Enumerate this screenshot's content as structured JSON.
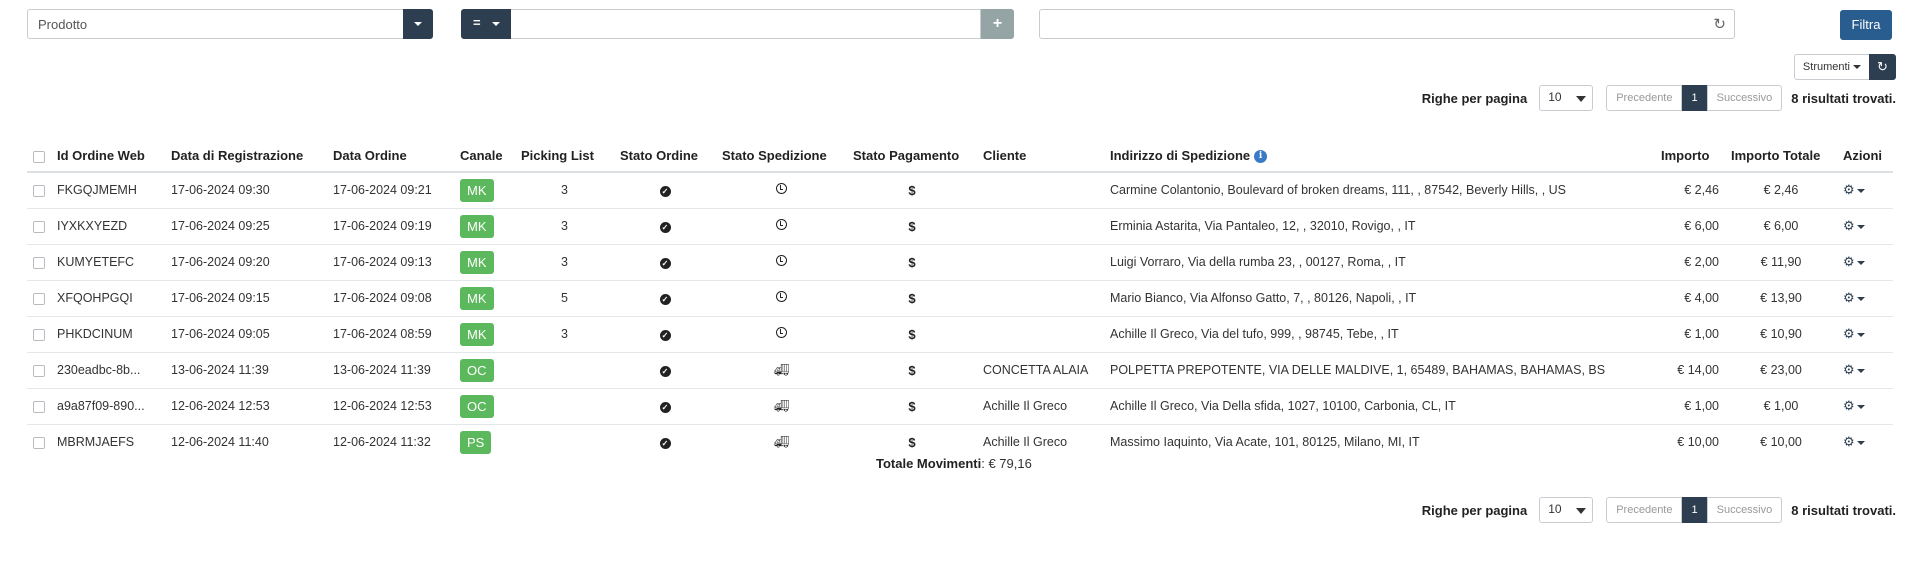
{
  "filter": {
    "field_value": "Prodotto",
    "operator_label": "=",
    "value_input": "",
    "add_label": "+",
    "search_value": "",
    "filtra_label": "Filtra"
  },
  "tools": {
    "strumenti_label": "Strumenti",
    "reload_icon": "refresh-icon"
  },
  "pagination": {
    "rows_label": "Righe per pagina",
    "rows_value": "10",
    "prev_label": "Precedente",
    "current_page": "1",
    "next_label": "Successivo",
    "results_text": "8 risultati trovati."
  },
  "table": {
    "headers": {
      "id": "Id Ordine Web",
      "reg": "Data di Registrazione",
      "date": "Data Ordine",
      "channel": "Canale",
      "picking": "Picking List",
      "order_state": "Stato Ordine",
      "ship_state": "Stato Spedizione",
      "pay_state": "Stato Pagamento",
      "client": "Cliente",
      "address": "Indirizzo di Spedizione",
      "amount": "Importo",
      "total": "Importo Totale",
      "actions": "Azioni"
    },
    "rows": [
      {
        "id": "FKGQJMEMH",
        "reg": "17-06-2024 09:30",
        "date": "17-06-2024 09:21",
        "channel": "MK",
        "picking": "3",
        "ship": "clock",
        "client": "",
        "address": "Carmine Colantonio, Boulevard of broken dreams, 111, , 87542, Beverly Hills, , US",
        "amount": "€ 2,46",
        "total": "€ 2,46"
      },
      {
        "id": "IYXKXYEZD",
        "reg": "17-06-2024 09:25",
        "date": "17-06-2024 09:19",
        "channel": "MK",
        "picking": "3",
        "ship": "clock",
        "client": "",
        "address": "Erminia Astarita, Via Pantaleo, 12, , 32010, Rovigo, , IT",
        "amount": "€ 6,00",
        "total": "€ 6,00"
      },
      {
        "id": "KUMYETEFC",
        "reg": "17-06-2024 09:20",
        "date": "17-06-2024 09:13",
        "channel": "MK",
        "picking": "3",
        "ship": "clock",
        "client": "",
        "address": "Luigi Vorraro, Via della rumba 23, , 00127, Roma, , IT",
        "amount": "€ 2,00",
        "total": "€ 11,90"
      },
      {
        "id": "XFQOHPGQI",
        "reg": "17-06-2024 09:15",
        "date": "17-06-2024 09:08",
        "channel": "MK",
        "picking": "5",
        "ship": "clock",
        "client": "",
        "address": "Mario Bianco, Via Alfonso Gatto, 7, , 80126, Napoli, , IT",
        "amount": "€ 4,00",
        "total": "€ 13,90"
      },
      {
        "id": "PHKDCINUM",
        "reg": "17-06-2024 09:05",
        "date": "17-06-2024 08:59",
        "channel": "MK",
        "picking": "3",
        "ship": "clock",
        "client": "",
        "address": "Achille Il Greco, Via del tufo, 999, , 98745, Tebe, , IT",
        "amount": "€ 1,00",
        "total": "€ 10,90"
      },
      {
        "id": "230eadbc-8b...",
        "reg": "13-06-2024 11:39",
        "date": "13-06-2024 11:39",
        "channel": "OC",
        "picking": "",
        "ship": "truck",
        "client": "CONCETTA ALAIA",
        "address": "POLPETTA PREPOTENTE, VIA DELLE MALDIVE, 1, 65489, BAHAMAS, BAHAMAS, BS",
        "amount": "€ 14,00",
        "total": "€ 23,00"
      },
      {
        "id": "a9a87f09-890...",
        "reg": "12-06-2024 12:53",
        "date": "12-06-2024 12:53",
        "channel": "OC",
        "picking": "",
        "ship": "truck",
        "client": "Achille Il Greco",
        "address": "Achille Il Greco, Via Della sfida, 1027, 10100, Carbonia, CL, IT",
        "amount": "€ 1,00",
        "total": "€ 1,00"
      },
      {
        "id": "MBRMJAEFS",
        "reg": "12-06-2024 11:40",
        "date": "12-06-2024 11:32",
        "channel": "PS",
        "picking": "",
        "ship": "truck",
        "client": "Achille Il Greco",
        "address": "Massimo Iaquinto, Via Acate, 101, 80125, Milano, MI, IT",
        "amount": "€ 10,00",
        "total": "€ 10,00"
      }
    ]
  },
  "totals": {
    "label": "Totale Movimenti",
    "value": ": € 79,16"
  },
  "colors": {
    "primary_dark": "#2c3e50",
    "filtra_blue": "#2a5d8f",
    "badge_green": "#5cb85c",
    "info_blue": "#3a7bc8"
  }
}
